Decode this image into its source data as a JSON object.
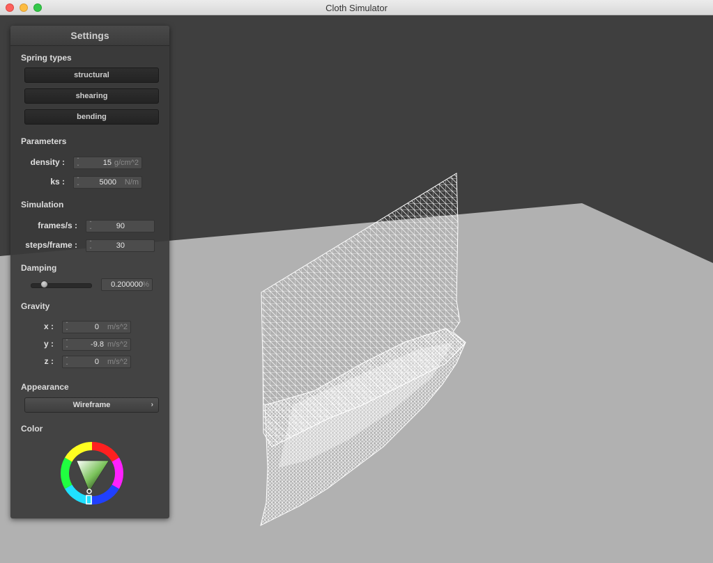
{
  "window": {
    "title": "Cloth Simulator"
  },
  "panel": {
    "title": "Settings",
    "spring_types": {
      "heading": "Spring types",
      "buttons": [
        "structural",
        "shearing",
        "bending"
      ]
    },
    "parameters": {
      "heading": "Parameters",
      "density": {
        "label": "density :",
        "value": "15",
        "unit": "g/cm^2"
      },
      "ks": {
        "label": "ks :",
        "value": "5000",
        "unit": "N/m"
      }
    },
    "simulation": {
      "heading": "Simulation",
      "frames_per_s": {
        "label": "frames/s :",
        "value": "90"
      },
      "steps_per_frame": {
        "label": "steps/frame :",
        "value": "30"
      }
    },
    "damping": {
      "heading": "Damping",
      "slider_fraction": 0.2,
      "value": "0.200000",
      "unit": "%"
    },
    "gravity": {
      "heading": "Gravity",
      "x": {
        "label": "x :",
        "value": "0",
        "unit": "m/s^2"
      },
      "y": {
        "label": "y :",
        "value": "-9.8",
        "unit": "m/s^2"
      },
      "z": {
        "label": "z :",
        "value": "0",
        "unit": "m/s^2"
      }
    },
    "appearance": {
      "heading": "Appearance",
      "selected": "Wireframe"
    },
    "color": {
      "heading": "Color",
      "selected_color": "#7ac25a"
    }
  },
  "icons": {
    "close": "close-icon",
    "minimize": "minimize-icon",
    "maximize": "maximize-icon",
    "spinner": "spinner-arrows-icon",
    "chevron": "chevron-right-icon"
  },
  "colors": {
    "background": "#3f3f3f",
    "floor": "#b1b1b1",
    "cloth_wire": "#ffffff",
    "panel": "#3a3a3a"
  }
}
